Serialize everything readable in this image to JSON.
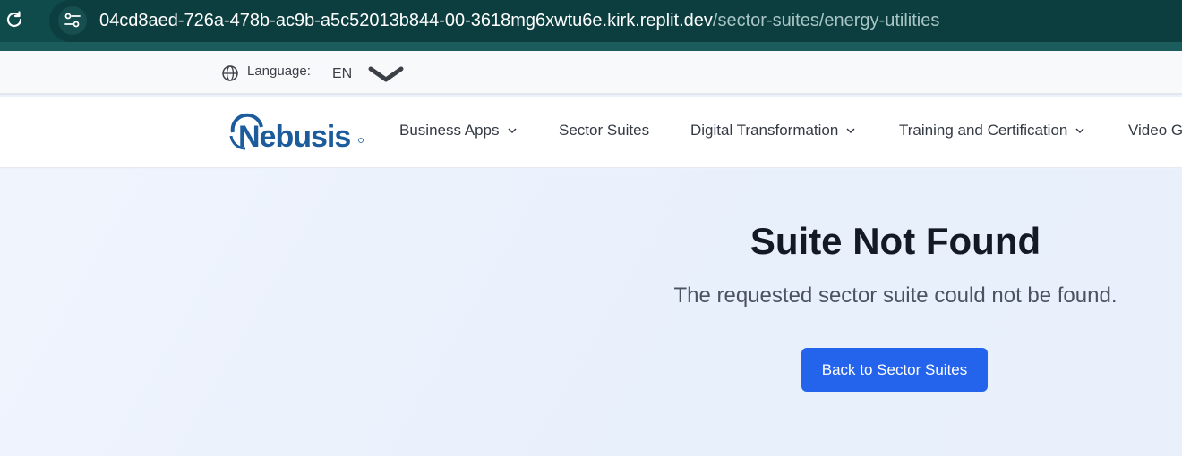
{
  "browser": {
    "url_host": "04cd8aed-726a-478b-ac9b-a5c52013b844-00-3618mg6xwtu6e.kirk.replit.dev",
    "url_path": "/sector-suites/energy-utilities",
    "reload_icon": "reload-icon",
    "site_info_icon": "tune-icon"
  },
  "language_bar": {
    "label": "Language:",
    "value": "EN",
    "icon": "globe-icon"
  },
  "nav": {
    "logo_text": "Nebusis",
    "items": [
      {
        "label": "Business Apps",
        "has_dropdown": true
      },
      {
        "label": "Sector Suites",
        "has_dropdown": false
      },
      {
        "label": "Digital Transformation",
        "has_dropdown": true
      },
      {
        "label": "Training and Certification",
        "has_dropdown": true
      },
      {
        "label": "Video G",
        "has_dropdown": false
      }
    ]
  },
  "main": {
    "title": "Suite Not Found",
    "subtitle": "The requested sector suite could not be found.",
    "back_button": "Back to Sector Suites"
  },
  "colors": {
    "browser_bar": "#0f4b4b",
    "primary_button": "#2463eb",
    "logo_blue": "#1c5c9c"
  }
}
